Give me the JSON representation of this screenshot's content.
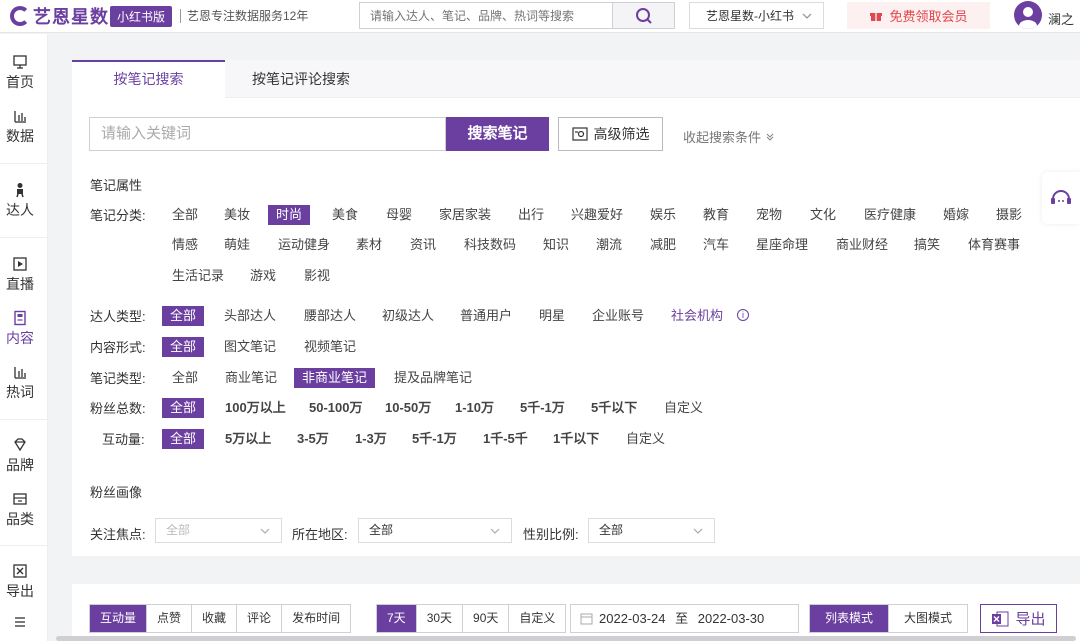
{
  "topbar": {
    "logo_text": "艺恩星数",
    "badge": "小红书版",
    "slogan": "艺恩专注数据服务12年",
    "search_placeholder": "请输入达人、笔记、品牌、热词等搜索",
    "platform": "艺恩星数-小红书",
    "vip": "免费领取会员",
    "username": "澜之"
  },
  "sidebar": {
    "items": [
      {
        "label": "首页",
        "icon": "monitor-icon"
      },
      {
        "label": "数据",
        "icon": "bar-chart-icon"
      },
      {
        "label": "达人",
        "icon": "person-icon"
      },
      {
        "label": "直播",
        "icon": "play-icon"
      },
      {
        "label": "内容",
        "icon": "document-icon"
      },
      {
        "label": "热词",
        "icon": "bar-chart-icon"
      },
      {
        "label": "品牌",
        "icon": "diamond-icon"
      },
      {
        "label": "品类",
        "icon": "box-icon"
      },
      {
        "label": "导出",
        "icon": "excel-icon"
      }
    ]
  },
  "tabs": [
    "按笔记搜索",
    "按笔记评论搜索"
  ],
  "search": {
    "placeholder": "请输入关键词",
    "button": "搜索笔记",
    "advanced": "高级筛选",
    "collapse": "收起搜索条件"
  },
  "note_attr_title": "笔记属性",
  "category": {
    "label": "笔记分类:",
    "options": [
      "全部",
      "美妆",
      "时尚",
      "美食",
      "母婴",
      "家居家装",
      "出行",
      "兴趣爱好",
      "娱乐",
      "教育",
      "宠物",
      "文化",
      "医疗健康",
      "婚嫁",
      "摄影",
      "情感",
      "萌娃",
      "运动健身",
      "素材",
      "资讯",
      "科技数码",
      "知识",
      "潮流",
      "减肥",
      "汽车",
      "星座命理",
      "商业财经",
      "搞笑",
      "体育赛事",
      "生活记录",
      "游戏",
      "影视"
    ],
    "selected": "时尚"
  },
  "kol_type": {
    "label": "达人类型:",
    "options": [
      "全部",
      "头部达人",
      "腰部达人",
      "初级达人",
      "普通用户",
      "明星",
      "企业账号",
      "社会机构"
    ],
    "selected": "全部"
  },
  "content_form": {
    "label": "内容形式:",
    "options": [
      "全部",
      "图文笔记",
      "视频笔记"
    ],
    "selected": "全部"
  },
  "note_type": {
    "label": "笔记类型:",
    "options": [
      "全部",
      "商业笔记",
      "非商业笔记",
      "提及品牌笔记"
    ],
    "selected": "非商业笔记"
  },
  "fans": {
    "label": "粉丝总数:",
    "options": [
      "全部",
      "100万以上",
      "50-100万",
      "10-50万",
      "1-10万",
      "5千-1万",
      "5千以下",
      "自定义"
    ],
    "selected": "全部"
  },
  "interaction": {
    "label": "互动量:",
    "options": [
      "全部",
      "5万以上",
      "3-5万",
      "1-3万",
      "5千-1万",
      "1千-5千",
      "1千以下",
      "自定义"
    ],
    "selected": "全部"
  },
  "fan_profile": {
    "title": "粉丝画像",
    "focus_label": "关注焦点:",
    "focus_value": "全部",
    "region_label": "所在地区:",
    "region_value": "全部",
    "gender_label": "性别比例:",
    "gender_value": "全部"
  },
  "toolbar": {
    "sort": [
      "互动量",
      "点赞",
      "收藏",
      "评论",
      "发布时间"
    ],
    "sort_selected": "互动量",
    "range": [
      "7天",
      "30天",
      "90天",
      "自定义"
    ],
    "range_selected": "7天",
    "date_from": "2022-03-24",
    "date_sep": "至",
    "date_to": "2022-03-30",
    "view": [
      "列表模式",
      "大图模式"
    ],
    "view_selected": "列表模式",
    "export": "导出"
  },
  "colors": {
    "accent": "#6b3fa0",
    "vip_red": "#e0474d"
  }
}
